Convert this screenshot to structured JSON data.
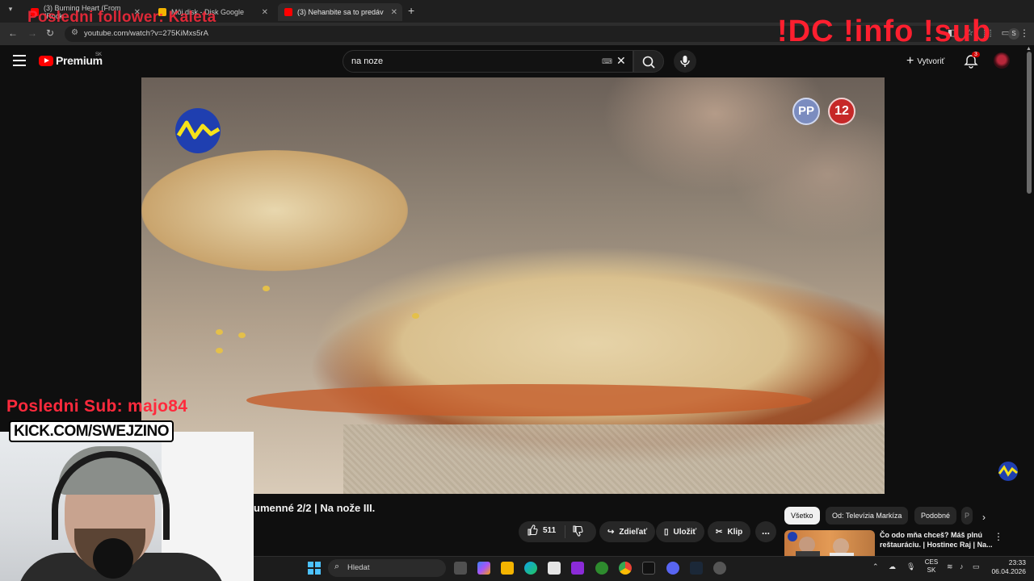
{
  "browser": {
    "tabs": [
      {
        "title": "(3) Burning Heart (From \"Rock",
        "active": false,
        "favicon_color": "#ff0000"
      },
      {
        "title": "Môj disk - Disk Google",
        "active": false,
        "favicon_color": "#f4b400"
      },
      {
        "title": "(3) Nehanbite sa to predáv",
        "active": true,
        "favicon_color": "#ff0000"
      }
    ],
    "url": "youtube.com/watch?v=275KiMxs5rA",
    "profile_initial": "S"
  },
  "overlays": {
    "follower": "Posledni follower: Kaleta",
    "commands": "!DC !info !sub",
    "last_sub": "Posledni Sub: majo84",
    "kick": "KICK.COM/SWEJZINO"
  },
  "youtube": {
    "logo_text": "Premium",
    "region": "SK",
    "search_value": "na noze",
    "create_label": "Vytvoriť",
    "notification_count": "3",
    "video_badges": {
      "pp": "PP",
      "age": "12"
    },
    "video_title": "umenné 2/2 | Na nože III.",
    "actions": {
      "likes": "511",
      "share": "Zdieľať",
      "save": "Uložiť",
      "clip": "Klip",
      "more": "..."
    },
    "chips": [
      "Všetko",
      "Od: Televízia Markíza",
      "Podobné",
      "P"
    ],
    "recommendation": {
      "title": "Čo odo mňa chceš? Máš plnú reštauráciu. | Hostinec Raj | Na..."
    }
  },
  "taskbar": {
    "search_placeholder": "Hledat",
    "lang_top": "CES",
    "lang_bottom": "SK",
    "time": "23:33",
    "date": "06.04.2026"
  },
  "colors": {
    "overlay_red": "#ff1f2f",
    "yt_red": "#ff0000",
    "brand_blue": "#1f3fb0"
  }
}
